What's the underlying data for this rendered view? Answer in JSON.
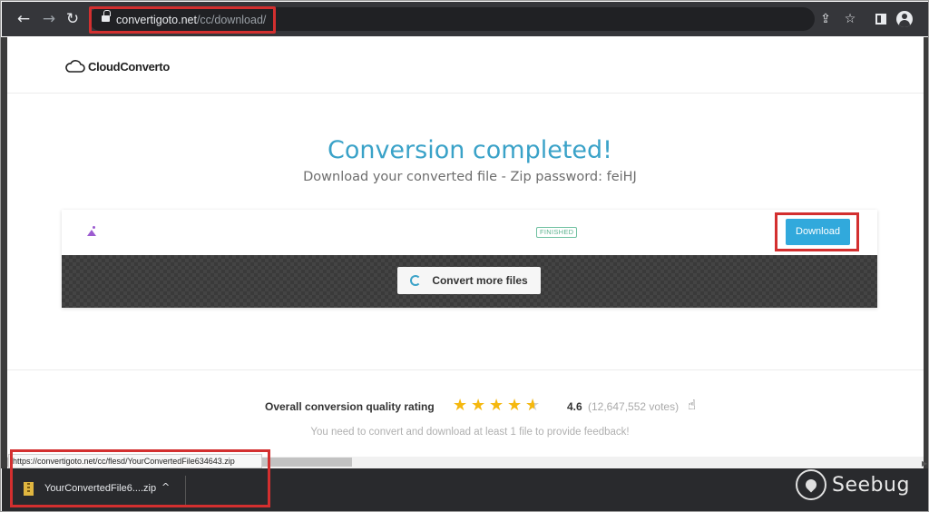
{
  "browser": {
    "url_domain": "convertigoto.net",
    "url_path": "/cc/download/",
    "status_url": "https://convertigoto.net/cc/flesd/YourConvertedFile634643.zip"
  },
  "site": {
    "logo_text": "CloudConverto"
  },
  "main": {
    "title": "Conversion completed!",
    "subtitle": "Download your converted file - Zip password: feiHJ",
    "file_status": "FINISHED",
    "download_label": "Download",
    "convert_more_label": "Convert more files"
  },
  "rating": {
    "label": "Overall conversion quality rating",
    "stars": 4.5,
    "value": "4.6",
    "votes": "(12,647,552 votes)",
    "note": "You need to convert and download at least 1 file to provide feedback!"
  },
  "download_shelf": {
    "file_name": "YourConvertedFile6....zip"
  },
  "watermark": {
    "text": "Seebug"
  },
  "colors": {
    "accent": "#3aa2c8",
    "download_button": "#31a9dc",
    "star": "#f5b80f",
    "highlight_box": "#d32f2f"
  }
}
